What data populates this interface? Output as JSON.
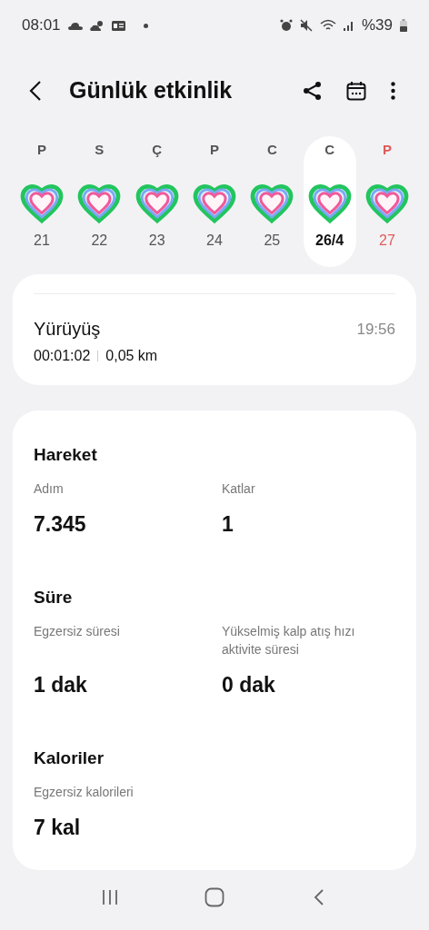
{
  "status_bar": {
    "time": "08:01",
    "battery": "%39"
  },
  "header": {
    "title": "Günlük etkinlik"
  },
  "days": [
    {
      "letter": "P",
      "date": "21",
      "selected": false,
      "highlight": false
    },
    {
      "letter": "S",
      "date": "22",
      "selected": false,
      "highlight": false
    },
    {
      "letter": "Ç",
      "date": "23",
      "selected": false,
      "highlight": false
    },
    {
      "letter": "P",
      "date": "24",
      "selected": false,
      "highlight": false
    },
    {
      "letter": "C",
      "date": "25",
      "selected": false,
      "highlight": false
    },
    {
      "letter": "C",
      "date": "26/4",
      "selected": true,
      "highlight": false
    },
    {
      "letter": "P",
      "date": "27",
      "selected": false,
      "highlight": true
    }
  ],
  "workout": {
    "name": "Yürüyüş",
    "duration": "00:01:02",
    "distance": "0,05 km",
    "time": "19:56"
  },
  "sections": [
    {
      "title": "Hareket",
      "stats": [
        {
          "label": "Adım",
          "value": "7.345"
        },
        {
          "label": "Katlar",
          "value": "1"
        }
      ]
    },
    {
      "title": "Süre",
      "stats": [
        {
          "label": "Egzersiz süresi",
          "value": "1 dak"
        },
        {
          "label": "Yükselmiş kalp atış hızı aktivite süresi",
          "value": "0 dak"
        }
      ]
    },
    {
      "title": "Kaloriler",
      "stats": [
        {
          "label": "Egzersiz kalorileri",
          "value": "7 kal"
        }
      ]
    }
  ]
}
